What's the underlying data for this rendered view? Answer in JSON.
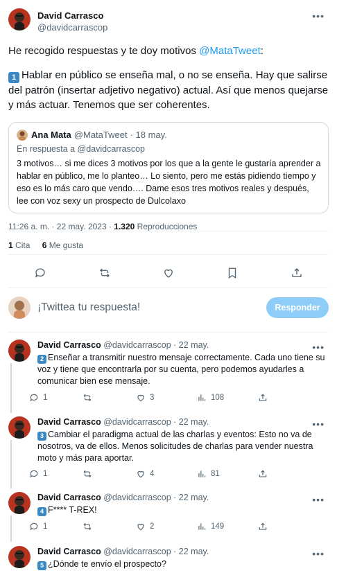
{
  "main_tweet": {
    "author_name": "David Carrasco",
    "author_handle": "@davidcarrascop",
    "intro_text": "He recogido respuestas y te doy motivos ",
    "intro_mention": "@MataTweet",
    "intro_suffix": ":",
    "point_number": "1",
    "point_text": "Hablar en público se enseña mal, o no se enseña. Hay que salirse del patrón (insertar adjetivo negativo) actual. Así que menos quejarse y más actuar. Tenemos que ser coherentes.",
    "quote": {
      "author_name": "Ana Mata",
      "author_handle": "@MataTweet",
      "date": "· 18 may.",
      "replying_to": "En respuesta a @davidcarrascop",
      "text": "3 motivos… si me dices 3 motivos por los que a la gente le gustaría aprender a hablar en público, me lo planteo… Lo siento, pero me estás pidiendo tiempo y eso es lo más caro que vendo…. Dame esos tres motivos reales y después, lee con voz sexy un prospecto de Dulcolaxo"
    },
    "timestamp": "11:26 a. m. · 22 may. 2023 · ",
    "views_count": "1.320",
    "views_label": " Reproducciones",
    "quotes_count": "1",
    "quotes_label": " Cita",
    "likes_count": "6",
    "likes_label": " Me gusta"
  },
  "compose": {
    "placeholder": "¡Twittea tu respuesta!",
    "reply_button": "Responder"
  },
  "replies": [
    {
      "author_name": "David Carrasco",
      "author_handle": "@davidcarrascop",
      "date": "· 22 may.",
      "number": "2",
      "text": "Enseñar a transmitir nuestro mensaje correctamente. Cada uno tiene su voz y tiene que encontrarla por su cuenta, pero podemos ayudarles a comunicar bien ese mensaje.",
      "replies": "1",
      "retweets": "",
      "likes": "3",
      "views": "108"
    },
    {
      "author_name": "David Carrasco",
      "author_handle": "@davidcarrascop",
      "date": "· 22 may.",
      "number": "3",
      "text": "Cambiar el paradigma actual de las charlas y eventos: Esto no va de nosotros, va de ellos. Menos solicitudes de charlas para vender nuestra moto y más para aportar.",
      "replies": "1",
      "retweets": "",
      "likes": "4",
      "views": "81"
    },
    {
      "author_name": "David Carrasco",
      "author_handle": "@davidcarrascop",
      "date": "· 22 may.",
      "number": "4",
      "text": "F**** T-REX!",
      "replies": "1",
      "retweets": "",
      "likes": "2",
      "views": "149"
    },
    {
      "author_name": "David Carrasco",
      "author_handle": "@davidcarrascop",
      "date": "· 22 may.",
      "number": "5",
      "text": "¿Dónde te envío el prospecto?"
    }
  ]
}
